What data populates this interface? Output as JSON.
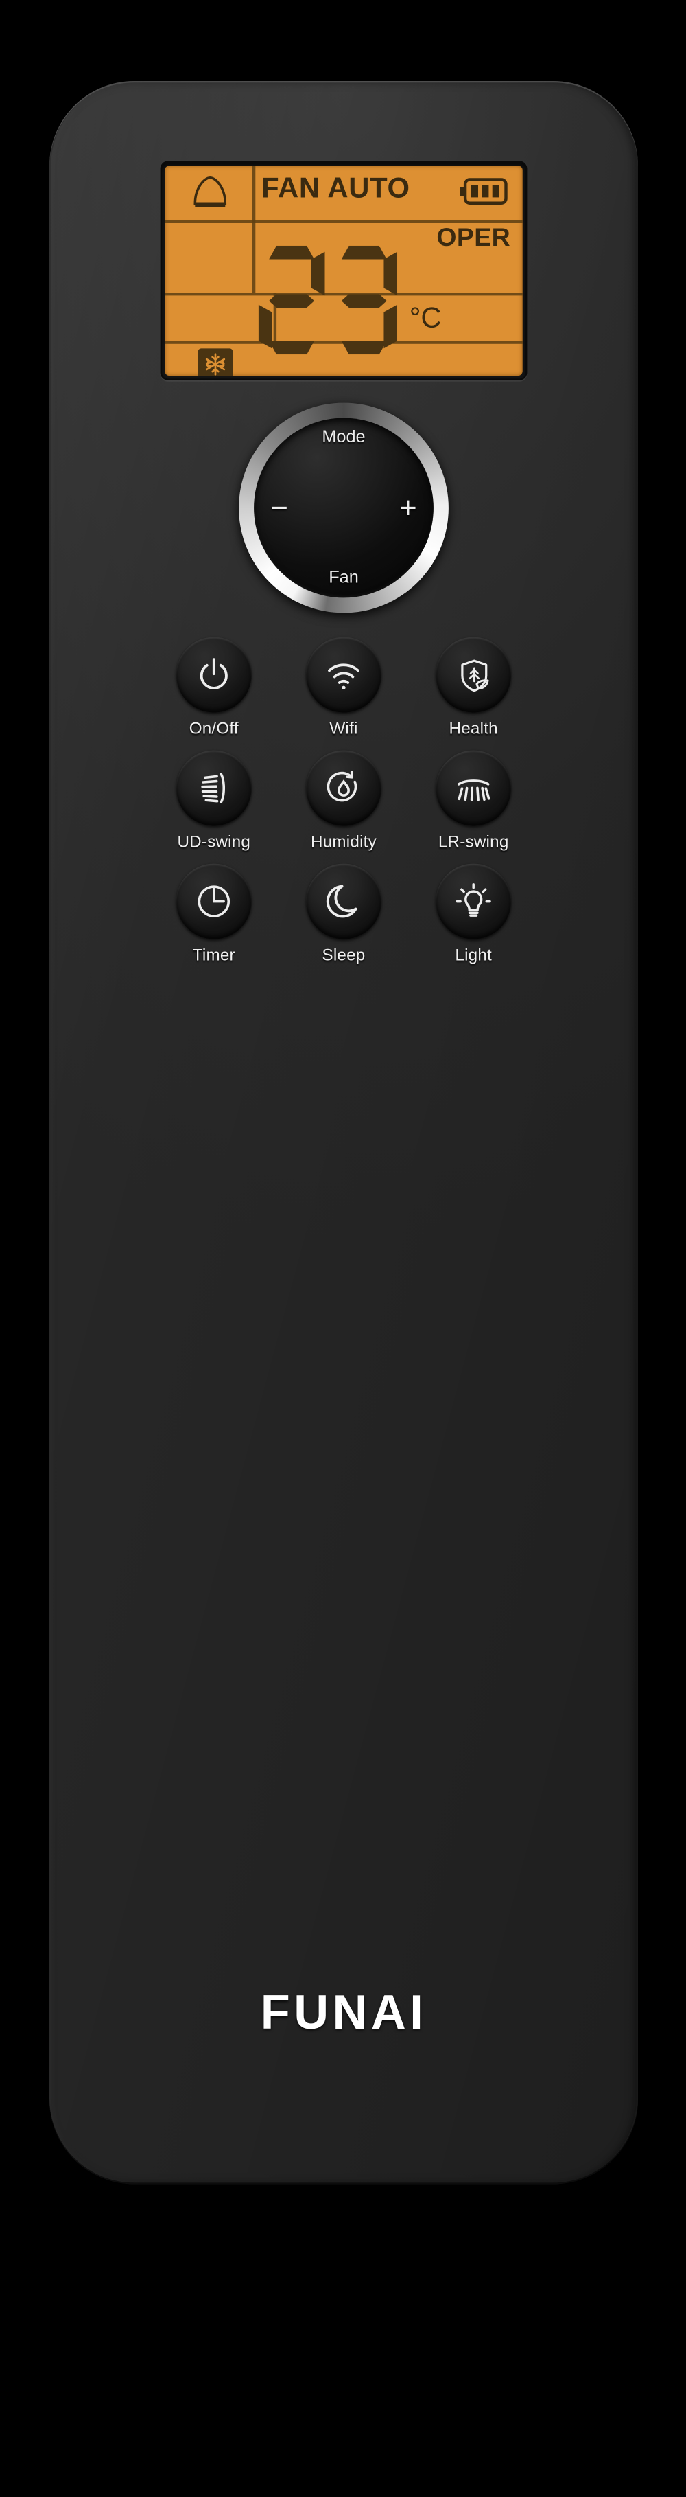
{
  "device": {
    "brand": "FUNAI",
    "type": "air-conditioner-remote"
  },
  "display": {
    "fan_mode_label": "FAN AUTO",
    "status_label": "OPER",
    "temperature": "23",
    "temperature_digits": [
      "2",
      "3"
    ],
    "unit": "°C",
    "battery_level": 3,
    "battery_icon": "battery-full-icon",
    "auto_icon": "auto-mode-icon",
    "operating_mode_icon": "snowflake-cool-icon",
    "backlight_color": "#dd9033",
    "ink_color": "#3a2a10"
  },
  "dial": {
    "top_label": "Mode",
    "bottom_label": "Fan",
    "left_label": "−",
    "right_label": "+"
  },
  "buttons": [
    {
      "label": "On/Off",
      "icon": "power-icon"
    },
    {
      "label": "Wifi",
      "icon": "wifi-icon"
    },
    {
      "label": "Health",
      "icon": "shield-leaf-icon"
    },
    {
      "label": "UD-swing",
      "icon": "vertical-swing-icon"
    },
    {
      "label": "Humidity",
      "icon": "water-drop-cycle-icon"
    },
    {
      "label": "LR-swing",
      "icon": "horizontal-swing-icon"
    },
    {
      "label": "Timer",
      "icon": "clock-icon"
    },
    {
      "label": "Sleep",
      "icon": "moon-icon"
    },
    {
      "label": "Light",
      "icon": "lightbulb-icon"
    }
  ]
}
